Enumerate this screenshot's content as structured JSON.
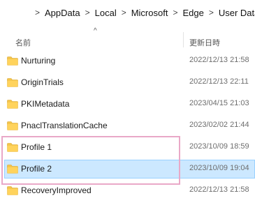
{
  "breadcrumb": {
    "separator": ">",
    "items": [
      "AppData",
      "Local",
      "Microsoft",
      "Edge",
      "User Data"
    ]
  },
  "columns": {
    "name": "名前",
    "date_modified": "更新日時",
    "sort_icon": "^"
  },
  "icons": {
    "folder": "folder-icon",
    "sort": "sort-ascending-icon"
  },
  "colors": {
    "folder": "#f3c44a",
    "selection_bg": "#cce8ff",
    "selection_border": "#99d1ff",
    "annotation_box": "#e9a8c7"
  },
  "files": [
    {
      "name": "Nurturing",
      "modified": "2022/12/13 21:58"
    },
    {
      "name": "OriginTrials",
      "modified": "2022/12/13 22:11"
    },
    {
      "name": "PKIMetadata",
      "modified": "2023/04/15 21:03"
    },
    {
      "name": "PnaclTranslationCache",
      "modified": "2023/02/02 21:44"
    },
    {
      "name": "Profile 1",
      "modified": "2023/10/09 18:59"
    },
    {
      "name": "Profile 2",
      "modified": "2023/10/09 19:04",
      "selected": true
    },
    {
      "name": "RecoveryImproved",
      "modified": "2022/12/13 21:58"
    }
  ]
}
